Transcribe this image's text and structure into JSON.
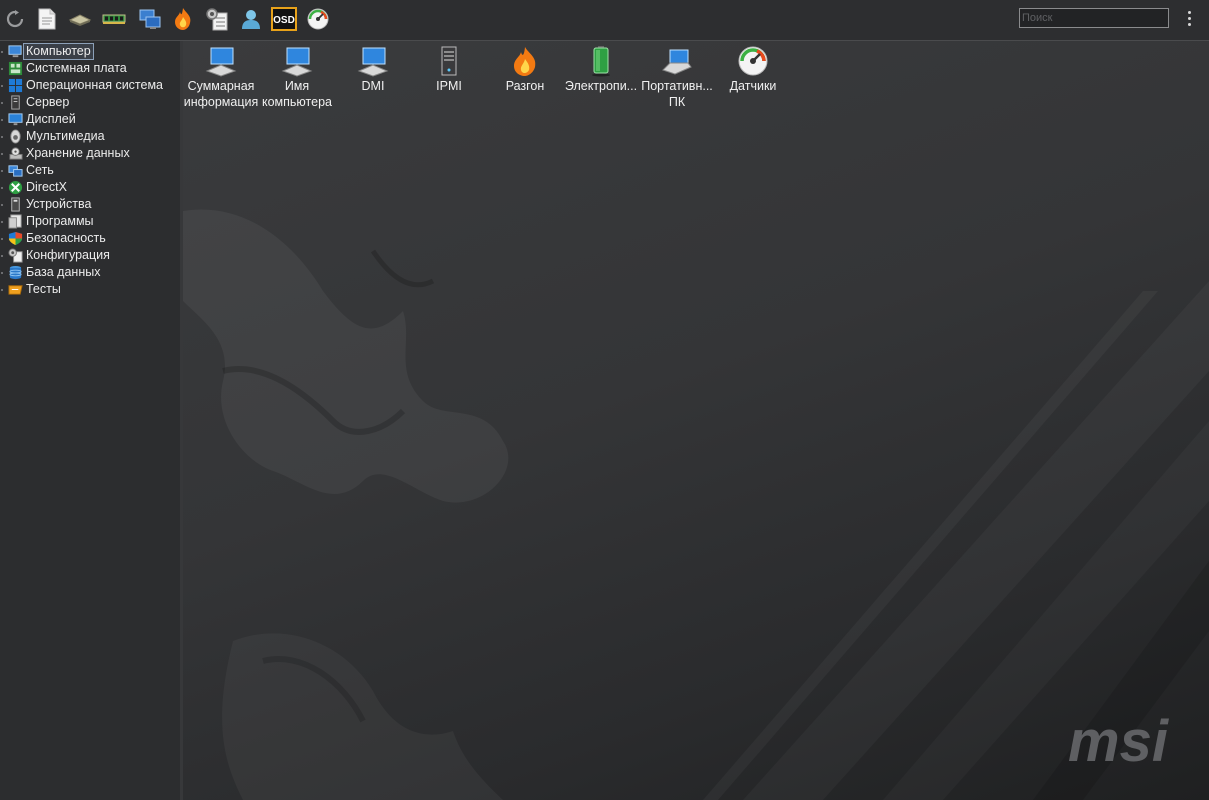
{
  "toolbar": {
    "buttons": [
      {
        "icon": "refresh-icon"
      },
      {
        "icon": "report-icon"
      },
      {
        "icon": "chip-icon"
      },
      {
        "icon": "memory-module-icon"
      },
      {
        "icon": "network-computer-icon"
      },
      {
        "icon": "flame-icon"
      },
      {
        "icon": "settings-checklist-icon"
      },
      {
        "icon": "user-icon"
      },
      {
        "icon": "osd-icon",
        "label": "OSD"
      },
      {
        "icon": "gauge-icon"
      }
    ],
    "search_placeholder": "Поиск",
    "search_value": ""
  },
  "sidebar": {
    "items": [
      {
        "label": "Компьютер",
        "icon": "computer-icon",
        "selected": true
      },
      {
        "label": "Системная плата",
        "icon": "motherboard-icon"
      },
      {
        "label": "Операционная система",
        "icon": "windows-icon"
      },
      {
        "label": "Сервер",
        "icon": "server-icon"
      },
      {
        "label": "Дисплей",
        "icon": "display-icon"
      },
      {
        "label": "Мультимедиа",
        "icon": "speaker-icon"
      },
      {
        "label": "Хранение данных",
        "icon": "storage-icon"
      },
      {
        "label": "Сеть",
        "icon": "network-icon"
      },
      {
        "label": "DirectX",
        "icon": "xbox-icon"
      },
      {
        "label": "Устройства",
        "icon": "devices-icon"
      },
      {
        "label": "Программы",
        "icon": "programs-icon"
      },
      {
        "label": "Безопасность",
        "icon": "security-shield-icon"
      },
      {
        "label": "Конфигурация",
        "icon": "configuration-icon"
      },
      {
        "label": "База данных",
        "icon": "database-icon"
      },
      {
        "label": "Тесты",
        "icon": "benchmark-icon"
      }
    ]
  },
  "main": {
    "icons": [
      {
        "label": "Суммарная\nинформация",
        "icon": "computer-summary-icon"
      },
      {
        "label": "Имя\nкомпьютера",
        "icon": "computer-name-icon"
      },
      {
        "label": "DMI",
        "icon": "dmi-icon"
      },
      {
        "label": "IPMI",
        "icon": "ipmi-server-icon"
      },
      {
        "label": "Разгон",
        "icon": "overclock-flame-icon"
      },
      {
        "label": "Электропи...",
        "icon": "battery-icon"
      },
      {
        "label": "Портативн...\nПК",
        "icon": "laptop-icon"
      },
      {
        "label": "Датчики",
        "icon": "sensors-gauge-icon"
      }
    ],
    "logo_text": "msi"
  },
  "colors": {
    "background": "#2b2c2e",
    "selection_outline": "#8ca0b8",
    "text": "#ececec"
  }
}
